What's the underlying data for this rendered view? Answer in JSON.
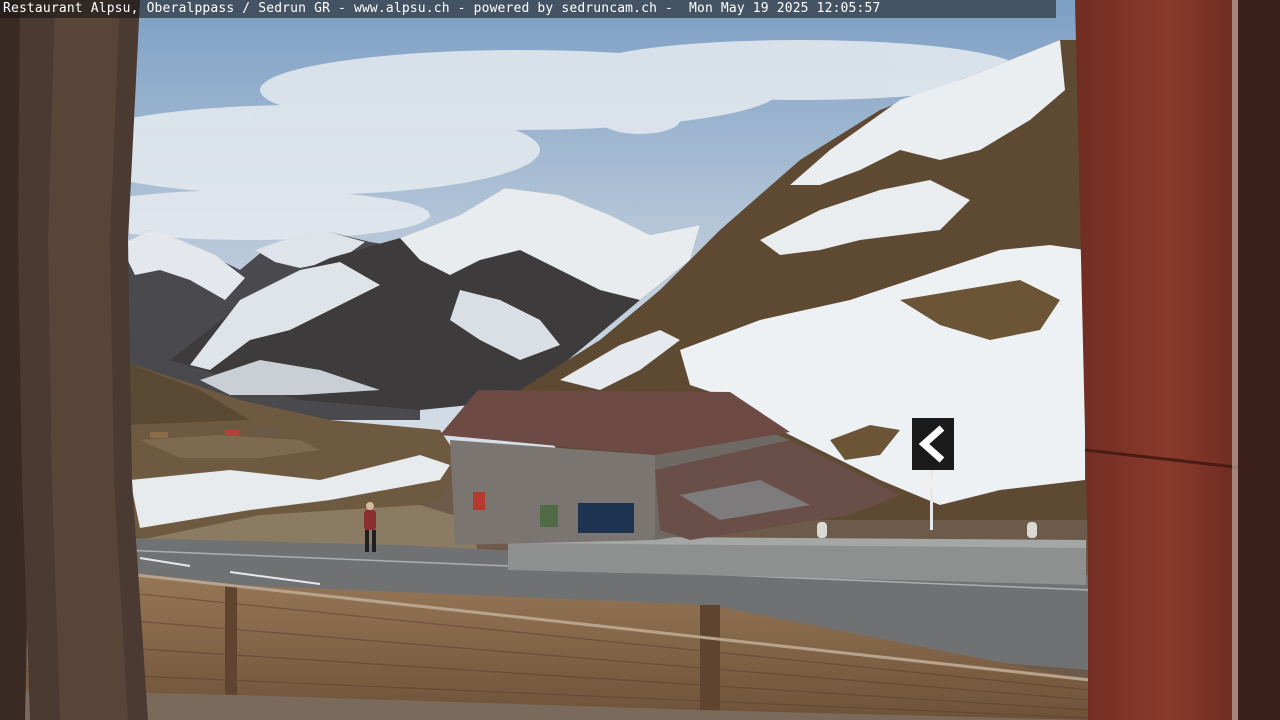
{
  "overlay": {
    "caption": "Restaurant Alpsu, Oberalppass / Sedrun GR - www.alpsu.ch - powered by sedruncam.ch -  Mon May 19 2025 12:05:57"
  },
  "scene": {
    "sky_color": "#9cb4cc",
    "snow_color": "#e9edf0",
    "rock_color": "#3d3a3a",
    "grass_color": "#6b5536",
    "road_color": "#6e6f71",
    "frame_color": "#7a3226",
    "fence_color": "#8a6a4c"
  }
}
